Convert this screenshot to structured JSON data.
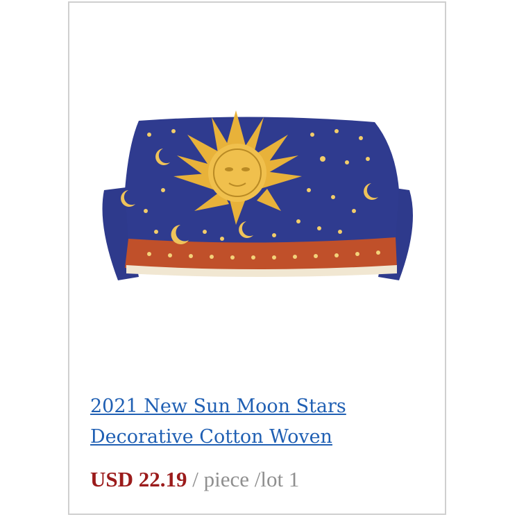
{
  "product": {
    "title": "2021 New Sun Moon Stars Decorative Cotton Woven",
    "price": "USD 22.19",
    "unit": "/ piece /lot 1",
    "image_icon": "sofa-throw-blanket-image",
    "colors": {
      "title_link": "#1f5fb3",
      "price": "#9b1b1b",
      "unit": "#8f8f8f",
      "blanket_blue": "#2e3a8c",
      "sun_gold": "#e8b23a",
      "border_orange": "#c0502a"
    }
  }
}
